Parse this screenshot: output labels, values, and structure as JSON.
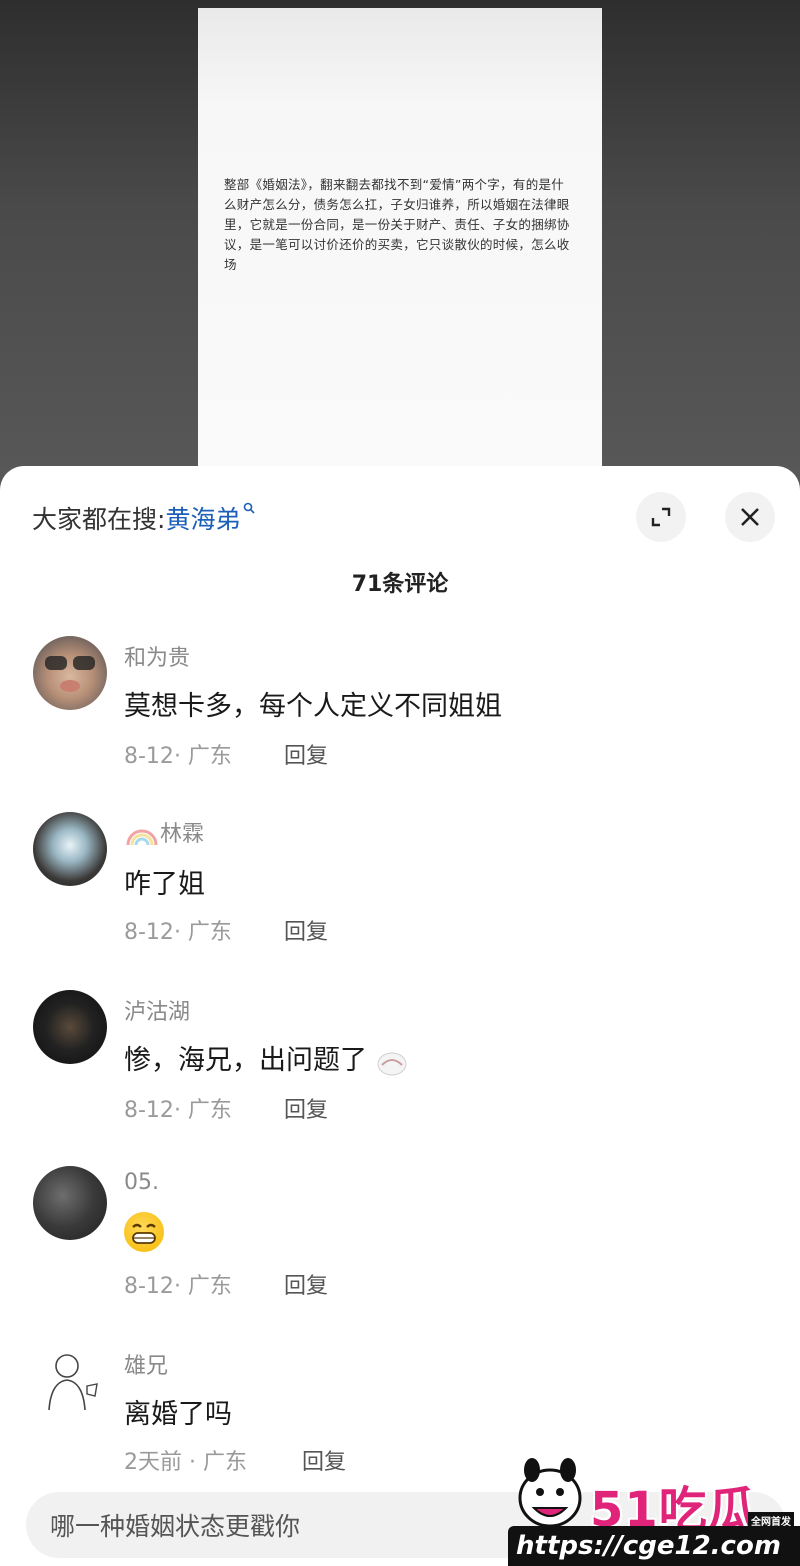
{
  "background": {
    "paper_text": "整部《婚姻法》，翻来翻去都找不到“爱情”两个字，有的是什么财产怎么分，债务怎么扛，子女归谁养，所以婚姻在法律眼里，它就是一份合同，是一份关于财产、责任、子女的捆绑协议，是一笔可以讨价还价的买卖，它只谈散伙的时候，怎么收场"
  },
  "header": {
    "search_prefix": "大家都在搜:",
    "search_term": "黄海弟",
    "expand_icon": "expand-icon",
    "close_icon": "close-icon"
  },
  "comment_count": "71条评论",
  "comments": [
    {
      "name": "和为贵",
      "text": "莫想卡多，每个人定义不同姐姐",
      "date": "8-12",
      "location": "· 广东",
      "reply": "回复"
    },
    {
      "name": "林霖",
      "text": "咋了姐",
      "date": "8-12",
      "location": "· 广东",
      "reply": "回复"
    },
    {
      "name": "泸沽湖",
      "text": "惨，海兄，出问题了",
      "date": "8-12",
      "location": "· 广东",
      "reply": "回复"
    },
    {
      "name": "05.",
      "text": "",
      "date": "8-12",
      "location": "· 广东",
      "reply": "回复"
    },
    {
      "name": "雄兄",
      "text": "离婚了吗",
      "date": "2天前",
      "location": " · 广东",
      "reply": "回复"
    }
  ],
  "input": {
    "placeholder": "哪一种婚姻状态更戳你"
  },
  "watermark": {
    "title": "51吃瓜",
    "badge": "全网首发",
    "url": "https://cge12.com"
  },
  "colors": {
    "accent_link": "#1b5fb8",
    "watermark_pink": "#e0247a"
  }
}
